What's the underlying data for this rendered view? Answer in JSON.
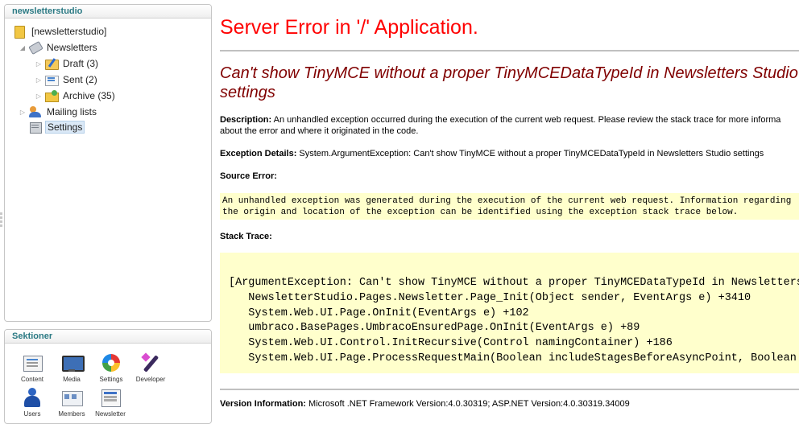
{
  "tree_panel": {
    "title": "newsletterstudio",
    "items": [
      {
        "label": "[newsletterstudio]",
        "icon": "folder-icon"
      },
      {
        "label": "Newsletters",
        "icon": "newsletters-icon"
      },
      {
        "label": "Draft (3)",
        "icon": "draft-icon"
      },
      {
        "label": "Sent (2)",
        "icon": "sent-icon"
      },
      {
        "label": "Archive (35)",
        "icon": "archive-icon"
      },
      {
        "label": "Mailing lists",
        "icon": "mailing-lists-icon"
      },
      {
        "label": "Settings",
        "icon": "settings-icon"
      }
    ]
  },
  "sections_panel": {
    "title": "Sektioner",
    "items": [
      {
        "label": "Content",
        "icon": "content-icon"
      },
      {
        "label": "Media",
        "icon": "media-icon"
      },
      {
        "label": "Settings",
        "icon": "settings-icon"
      },
      {
        "label": "Developer",
        "icon": "developer-icon"
      },
      {
        "label": "Users",
        "icon": "users-icon"
      },
      {
        "label": "Members",
        "icon": "members-icon"
      },
      {
        "label": "Newsletter",
        "icon": "newsletter-icon"
      }
    ]
  },
  "error_page": {
    "title": "Server Error in '/' Application.",
    "heading": "Can't show TinyMCE without a proper TinyMCEDataTypeId in Newsletters Studio settings",
    "description_label": "Description:",
    "description_text_1": " An unhandled exception occurred during the execution of the current web request. Please review the stack trace for more informa",
    "description_text_2": "about the error and where it originated in the code.",
    "exception_label": "Exception Details:",
    "exception_text": " System.ArgumentException: Can't show TinyMCE without a proper TinyMCEDataTypeId in Newsletters Studio settings",
    "source_error_label": "Source Error:",
    "source_error_lines": [
      "An unhandled exception was generated during the execution of the current web request. Information regarding",
      "the origin and location of the exception can be identified using the exception stack trace below."
    ],
    "stack_trace_label": "Stack Trace:",
    "stack_trace_lines": [
      "[ArgumentException: Can't show TinyMCE without a proper TinyMCEDataTypeId in Newsletters",
      "   NewsletterStudio.Pages.Newsletter.Page_Init(Object sender, EventArgs e) +3410",
      "   System.Web.UI.Page.OnInit(EventArgs e) +102",
      "   umbraco.BasePages.UmbracoEnsuredPage.OnInit(EventArgs e) +89",
      "   System.Web.UI.Control.InitRecursive(Control namingContainer) +186",
      "   System.Web.UI.Page.ProcessRequestMain(Boolean includeStagesBeforeAsyncPoint, Boolean"
    ],
    "version_label": "Version Information:",
    "version_text": " Microsoft .NET Framework Version:4.0.30319; ASP.NET Version:4.0.30319.34009"
  }
}
